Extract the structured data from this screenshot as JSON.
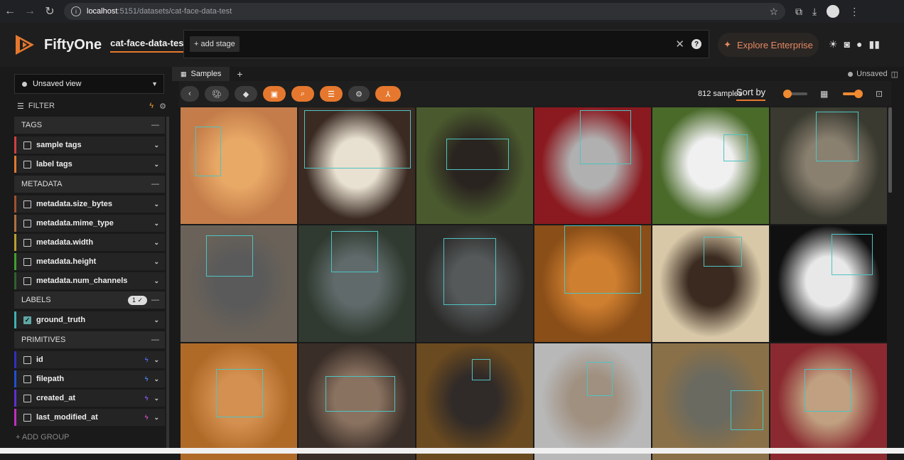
{
  "browser": {
    "url_host": "localhost",
    "url_path": ":5151/datasets/cat-face-data-test"
  },
  "header": {
    "brand": "FiftyOne",
    "dataset": "cat-face-data-test",
    "add_stage": "+ add stage",
    "explore": "Explore Enterprise"
  },
  "sidebar": {
    "view": "Unsaved view",
    "filter": "FILTER",
    "groups": {
      "tags": "TAGS",
      "metadata": "METADATA",
      "labels": "LABELS",
      "labels_badge": "1 ✓",
      "primitives": "PRIMITIVES"
    },
    "fields": {
      "sample_tags": "sample tags",
      "label_tags": "label tags",
      "size_bytes": "metadata.size_bytes",
      "mime_type": "metadata.mime_type",
      "width": "metadata.width",
      "height": "metadata.height",
      "num_channels": "metadata.num_channels",
      "ground_truth": "ground_truth",
      "id": "id",
      "filepath": "filepath",
      "created_at": "created_at",
      "last_modified_at": "last_modified_at"
    },
    "add_group": "+ ADD GROUP",
    "colors": {
      "tags": "#d04040",
      "label_tags": "#e07830",
      "size_bytes": "#a05030",
      "mime_type": "#b07040",
      "width": "#b8a030",
      "height": "#40a030",
      "num_channels": "#306030",
      "ground_truth": "#40b0b0",
      "id": "#3030c0",
      "filepath": "#2050d0",
      "created_at": "#6030d0",
      "last_modified_at": "#c030c0"
    }
  },
  "main": {
    "tab": "Samples",
    "status": "Unsaved",
    "sample_count": "812 samples",
    "sort_by": "Sort by"
  },
  "samples": [
    {
      "bg": "#c47d4a",
      "tone": "#e8a866"
    },
    {
      "bg": "#3a2a22",
      "tone": "#e8e0d0"
    },
    {
      "bg": "#4a5a2e",
      "tone": "#2a2420"
    },
    {
      "bg": "#8a1a20",
      "tone": "#b0b0b0"
    },
    {
      "bg": "#4a6a2a",
      "tone": "#f0f0f0"
    },
    {
      "bg": "#3a3a30",
      "tone": "#8a8070"
    },
    {
      "bg": "#6a6258",
      "tone": "#5a5a5a"
    },
    {
      "bg": "#303a30",
      "tone": "#606a6a"
    },
    {
      "bg": "#2a2a28",
      "tone": "#55595a"
    },
    {
      "bg": "#8a4e18",
      "tone": "#cf7f30"
    },
    {
      "bg": "#d8c8a8",
      "tone": "#3a2a20"
    },
    {
      "bg": "#101010",
      "tone": "#e8e8e8"
    },
    {
      "bg": "#b06a28",
      "tone": "#d49050"
    },
    {
      "bg": "#3a2e28",
      "tone": "#8a7260"
    },
    {
      "bg": "#6a4a20",
      "tone": "#302a28"
    },
    {
      "bg": "#b8b8b8",
      "tone": "#a09080"
    },
    {
      "bg": "#8a7048",
      "tone": "#6a6a60"
    },
    {
      "bg": "#8a2a30",
      "tone": "#c0a080"
    }
  ]
}
